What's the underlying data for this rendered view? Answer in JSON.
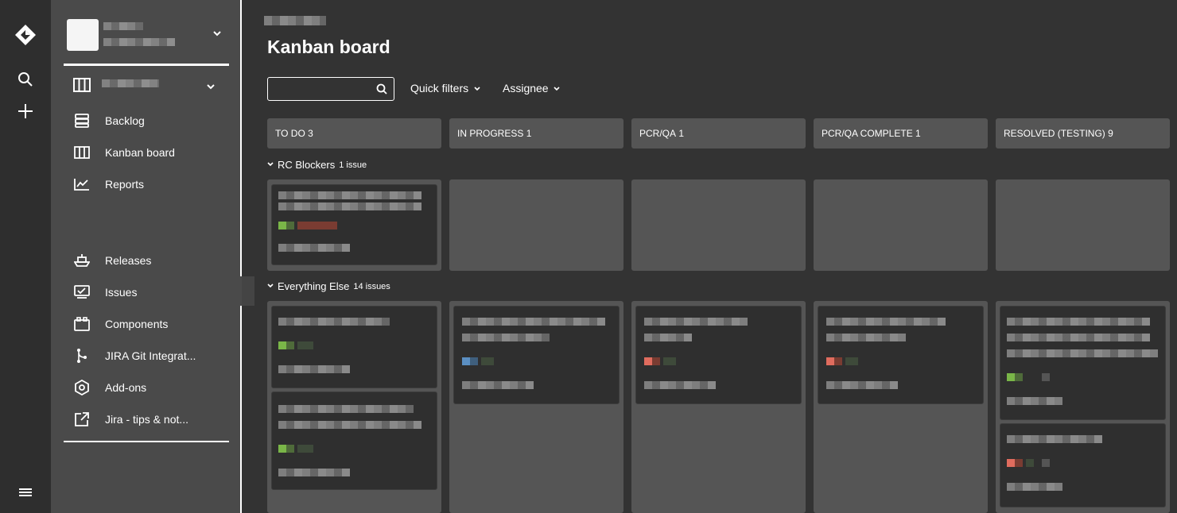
{
  "global_nav": {
    "logo_icon": "jira-logo-icon",
    "search_icon": "search-icon",
    "create_icon": "plus-icon",
    "menu_icon": "hamburger-icon"
  },
  "sidebar": {
    "items": [
      {
        "label": "Backlog",
        "icon": "backlog-icon"
      },
      {
        "label": "Kanban board",
        "icon": "board-icon"
      },
      {
        "label": "Reports",
        "icon": "reports-icon"
      },
      {
        "label": "Releases",
        "icon": "ship-icon"
      },
      {
        "label": "Issues",
        "icon": "issues-icon"
      },
      {
        "label": "Components",
        "icon": "components-icon"
      },
      {
        "label": "JIRA Git Integrat...",
        "icon": "git-icon"
      },
      {
        "label": "Add-ons",
        "icon": "addons-icon"
      },
      {
        "label": "Jira - tips & not...",
        "icon": "external-link-icon"
      }
    ]
  },
  "main": {
    "title": "Kanban board",
    "search": {
      "placeholder": ""
    },
    "filters": {
      "quick": "Quick filters",
      "assignee": "Assignee"
    },
    "columns": [
      {
        "name": "TO DO",
        "count": "3"
      },
      {
        "name": "IN PROGRESS",
        "count": "1"
      },
      {
        "name": "PCR/QA",
        "count": "1"
      },
      {
        "name": "PCR/QA COMPLETE",
        "count": "1"
      },
      {
        "name": "RESOLVED (TESTING)",
        "count": "9"
      }
    ],
    "swimlanes": [
      {
        "name": "RC Blockers",
        "count": "1 issue"
      },
      {
        "name": "Everything Else",
        "count": "14 issues"
      }
    ]
  },
  "colors": {
    "background": "#333333",
    "sidebar": "#4a4a4a",
    "column": "#555555",
    "card": "#2f2f2f"
  }
}
